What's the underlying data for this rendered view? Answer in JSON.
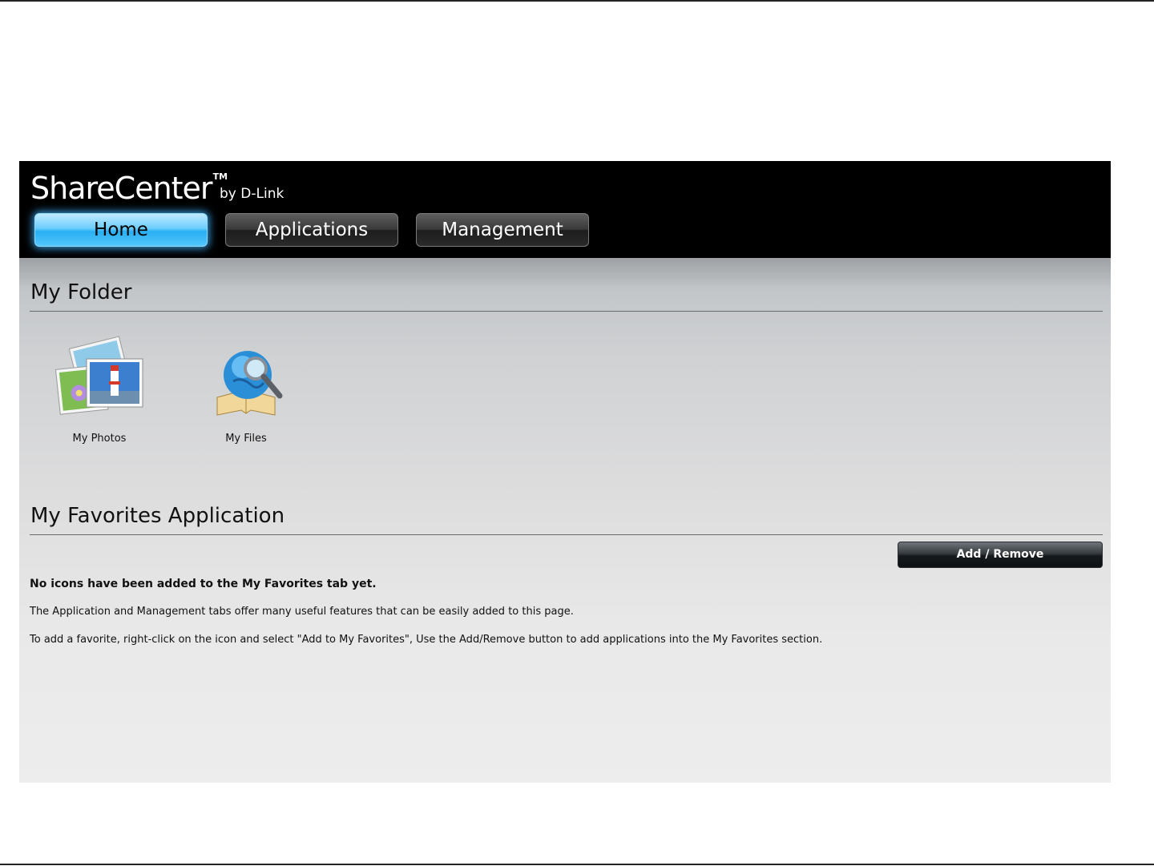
{
  "header": {
    "brand": "ShareCenter",
    "trademark": "TM",
    "by_line": "by D-Link"
  },
  "tabs": [
    {
      "label": "Home",
      "active": true
    },
    {
      "label": "Applications",
      "active": false
    },
    {
      "label": "Management",
      "active": false
    }
  ],
  "my_folder": {
    "title": "My Folder",
    "items": [
      {
        "label": "My Photos",
        "icon": "photos-icon"
      },
      {
        "label": "My Files",
        "icon": "globe-magnifier-book-icon"
      }
    ]
  },
  "favorites": {
    "title": "My Favorites Application",
    "add_remove_label": "Add / Remove",
    "empty_title": "No icons have been added to the My Favorites tab yet.",
    "line1": "The Application and Management tabs offer many useful features that can be easily added to this page.",
    "line2": "To add a favorite, right-click on the icon and select \"Add to My Favorites\", Use the Add/Remove button to add applications into the My Favorites section."
  },
  "colors": {
    "header_bg": "#000000",
    "active_tab": "#3cbaf8",
    "inactive_tab": "#333333",
    "content_top": "#9ea1a4",
    "content_bottom": "#ededed"
  }
}
